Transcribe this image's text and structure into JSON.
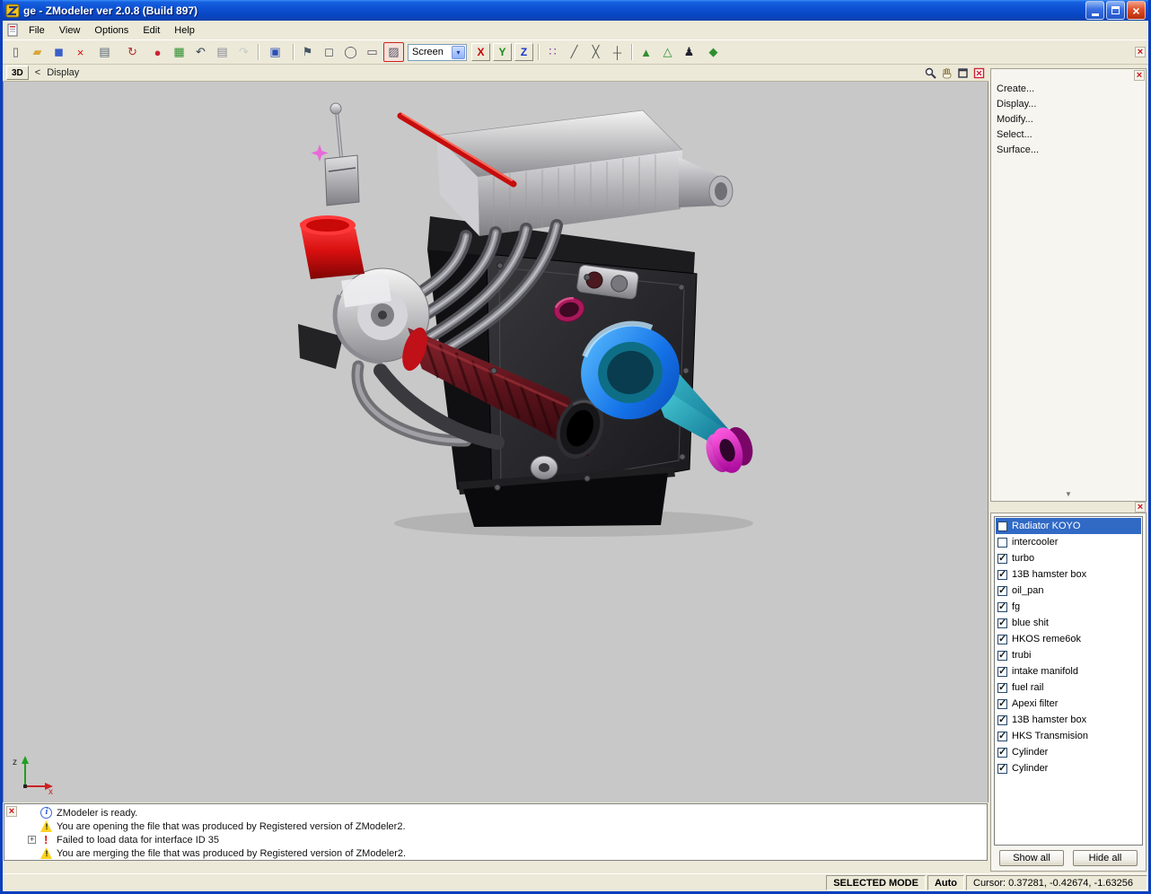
{
  "window": {
    "title": "ge - ZModeler ver 2.0.8 (Build 897)"
  },
  "menubar": {
    "items": [
      "File",
      "View",
      "Options",
      "Edit",
      "Help"
    ]
  },
  "toolbar": {
    "left_items": [
      {
        "name": "new-icon",
        "glyph": "▯",
        "color": "#4a5a7a"
      },
      {
        "name": "open-icon",
        "glyph": "▰",
        "color": "#d8a838"
      },
      {
        "name": "save-icon",
        "glyph": "◼",
        "color": "#3a5fc8"
      },
      {
        "name": "delete-icon",
        "glyph": "×",
        "color": "#cc1111"
      },
      {
        "name": "import-icon",
        "glyph": "▤",
        "color": "#556677",
        "dropdown": true
      },
      {
        "name": "export-icon",
        "glyph": "↻",
        "color": "#b03030",
        "dropdown": true
      },
      {
        "name": "material-editor-icon",
        "glyph": "●",
        "color": "#cc2233"
      },
      {
        "name": "render-icon",
        "glyph": "▦",
        "color": "#2f8f2f"
      },
      {
        "name": "undo-icon",
        "glyph": "↶",
        "color": "#334455"
      },
      {
        "name": "notes-icon",
        "glyph": "▤",
        "color": "#888899"
      },
      {
        "name": "redo-icon",
        "glyph": "↷",
        "color": "#99aabb",
        "disabled": true
      },
      {
        "sep": true
      },
      {
        "name": "primitives-icon",
        "glyph": "▣",
        "color": "#2a4fb8",
        "dropdown": true
      },
      {
        "sep": true
      },
      {
        "name": "select-single-icon",
        "glyph": "⚑",
        "color": "#445566"
      },
      {
        "name": "select-quad-icon",
        "glyph": "◻",
        "color": "#555566"
      },
      {
        "name": "select-circle-icon",
        "glyph": "◯",
        "color": "#555566"
      },
      {
        "name": "select-poly-icon",
        "glyph": "▭",
        "color": "#555566"
      },
      {
        "name": "select-paint-icon",
        "glyph": "▨",
        "color": "#555566",
        "active": true
      }
    ],
    "mode_select": {
      "value": "Screen"
    },
    "axis_buttons": [
      {
        "name": "axis-x-button",
        "label": "X",
        "color": "#cc0000"
      },
      {
        "name": "axis-y-button",
        "label": "Y",
        "color": "#1a8a1a"
      },
      {
        "name": "axis-z-button",
        "label": "Z",
        "color": "#1a35cc"
      }
    ],
    "right_items": [
      {
        "sep": true
      },
      {
        "name": "vertex-paint-icon",
        "glyph": "∷",
        "color": "#8833aa"
      },
      {
        "name": "knife-icon",
        "glyph": "╱",
        "color": "#555555"
      },
      {
        "name": "slice-icon",
        "glyph": "╳",
        "color": "#555555"
      },
      {
        "name": "measure-icon",
        "glyph": "┼",
        "color": "#555555"
      },
      {
        "sep": true
      },
      {
        "name": "attach-icon",
        "glyph": "▲",
        "color": "#2f8f2f"
      },
      {
        "name": "detach-icon",
        "glyph": "△",
        "color": "#2f8f2f"
      },
      {
        "name": "skeleton-icon",
        "glyph": "♟",
        "color": "#222233"
      },
      {
        "name": "morph-icon",
        "glyph": "◆",
        "color": "#2f8f2f",
        "dropdown": true
      }
    ]
  },
  "viewport": {
    "mode_button": "3D",
    "nav_back": "<",
    "nav_label": "Display",
    "header_icons": [
      "zoom-icon",
      "pan-icon",
      "maximize-icon",
      "close-icon"
    ],
    "axis": {
      "up": "z",
      "right": "x"
    }
  },
  "right_menu": {
    "items": [
      "Create...",
      "Display...",
      "Modify...",
      "Select...",
      "Surface..."
    ]
  },
  "objects_panel": {
    "items": [
      {
        "label": "Radiator KOYO",
        "checked": false,
        "selected": true
      },
      {
        "label": "intercooler",
        "checked": false
      },
      {
        "label": "turbo",
        "checked": true
      },
      {
        "label": "13B hamster box",
        "checked": true
      },
      {
        "label": "oil_pan",
        "checked": true
      },
      {
        "label": "fg",
        "checked": true
      },
      {
        "label": "blue shit",
        "checked": true
      },
      {
        "label": "HKOS reme6ok",
        "checked": true
      },
      {
        "label": "trubi",
        "checked": true
      },
      {
        "label": "intake manifold",
        "checked": true
      },
      {
        "label": "fuel rail",
        "checked": true
      },
      {
        "label": "Apexi filter",
        "checked": true
      },
      {
        "label": "13B hamster box",
        "checked": true
      },
      {
        "label": "HKS Transmision",
        "checked": true
      },
      {
        "label": "Cylinder",
        "checked": true
      },
      {
        "label": "Cylinder",
        "checked": true
      }
    ],
    "show_all_label": "Show all",
    "hide_all_label": "Hide all"
  },
  "log": {
    "messages": [
      {
        "type": "info",
        "text": "ZModeler is ready."
      },
      {
        "type": "warning",
        "text": "You are opening the file that was produced by Registered version of ZModeler2."
      },
      {
        "type": "error",
        "text": "Failed to load data for interface ID 35",
        "expander": true
      },
      {
        "type": "warning",
        "text": "You are merging the file that was produced by Registered version of ZModeler2."
      }
    ]
  },
  "statusbar": {
    "mode": "SELECTED MODE",
    "auto": "Auto",
    "cursor": "Cursor: 0.37281, -0.42674, -1.63256"
  },
  "colors": {
    "selection": "#316ac5",
    "titlebar": "#0c4fd0",
    "axis_x": "#cc2222",
    "axis_z": "#1f9f1f",
    "viewport_bg": "#c8c8c8"
  }
}
